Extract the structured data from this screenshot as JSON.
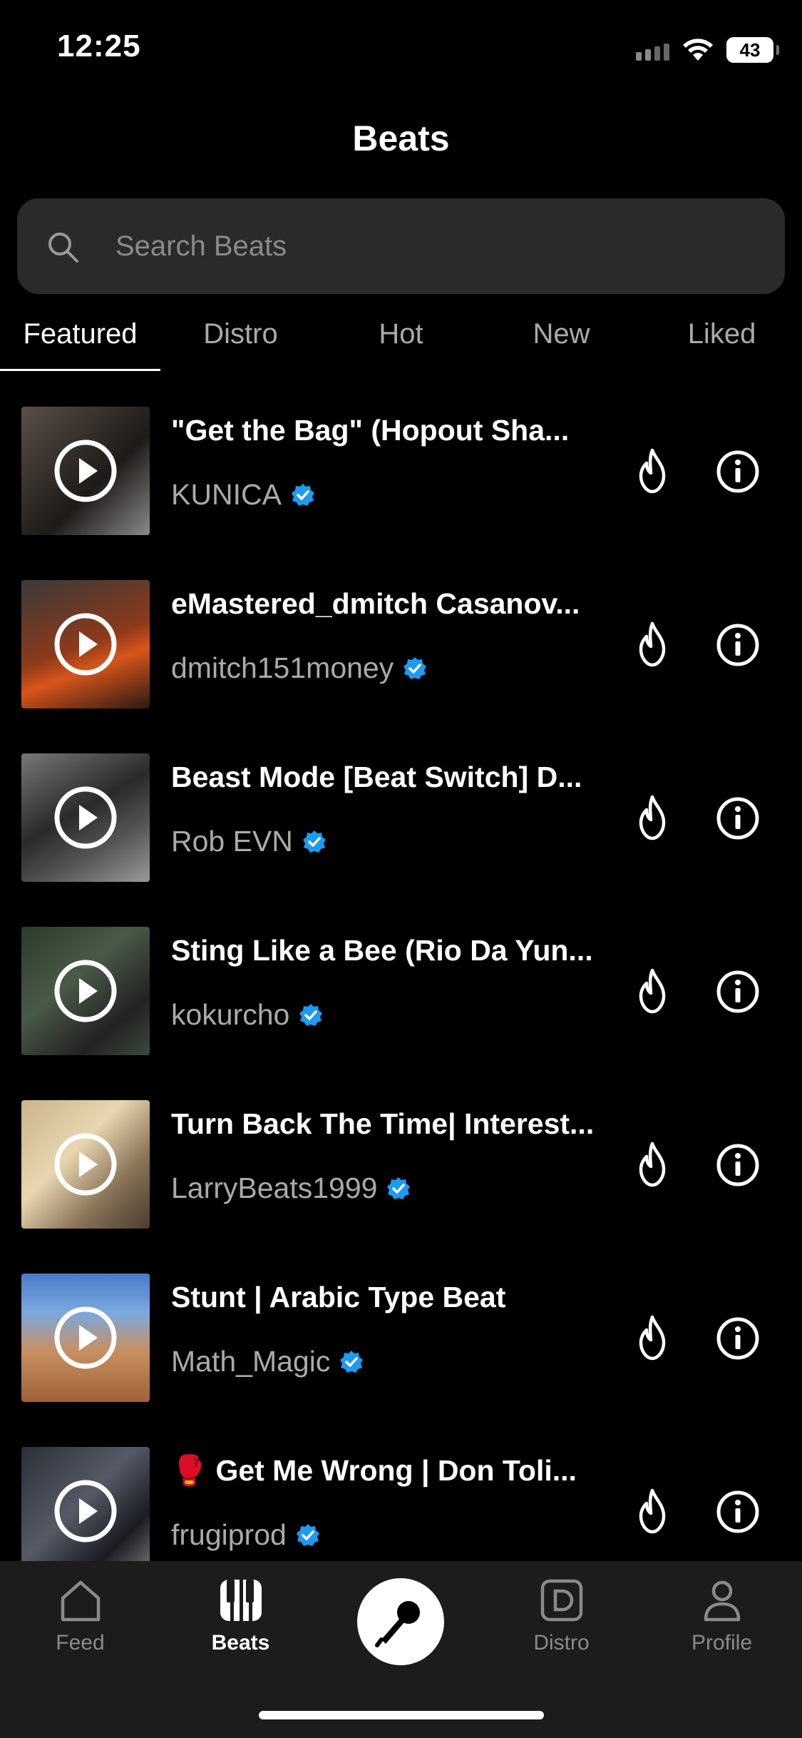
{
  "status_bar": {
    "time": "12:25",
    "battery": "43"
  },
  "header": {
    "title": "Beats"
  },
  "search": {
    "placeholder": "Search Beats",
    "value": ""
  },
  "tabs": [
    {
      "label": "Featured",
      "active": true
    },
    {
      "label": "Distro",
      "active": false
    },
    {
      "label": "Hot",
      "active": false
    },
    {
      "label": "New",
      "active": false
    },
    {
      "label": "Liked",
      "active": false
    }
  ],
  "beats": [
    {
      "title": "\"Get the Bag\" (Hopout Sha...",
      "artist": "KUNICA",
      "verified": true
    },
    {
      "title": "eMastered_dmitch  Casanov...",
      "artist": "dmitch151money",
      "verified": true
    },
    {
      "title": "Beast Mode [Beat Switch] D...",
      "artist": "Rob EVN",
      "verified": true
    },
    {
      "title": "Sting Like a Bee (Rio Da Yun...",
      "artist": "kokurcho",
      "verified": true
    },
    {
      "title": "Turn Back The Time| Interest...",
      "artist": "LarryBeats1999",
      "verified": true
    },
    {
      "title": "Stunt | Arabic Type Beat",
      "artist": "Math_Magic",
      "verified": true
    },
    {
      "title": "🥊 Get Me Wrong | Don Toli...",
      "artist": "frugiprod",
      "verified": true
    }
  ],
  "bottom_nav": {
    "feed": "Feed",
    "beats": "Beats",
    "distro": "Distro",
    "profile": "Profile"
  },
  "colors": {
    "verified": "#1d9bf0",
    "tab_bar": "#1c1c1c",
    "search_bg": "#2a2a2a"
  },
  "icons": [
    "search-icon",
    "play-icon",
    "fire-icon",
    "info-icon",
    "verified-icon",
    "home-icon",
    "piano-icon",
    "microphone-icon",
    "distro-icon",
    "profile-icon"
  ]
}
